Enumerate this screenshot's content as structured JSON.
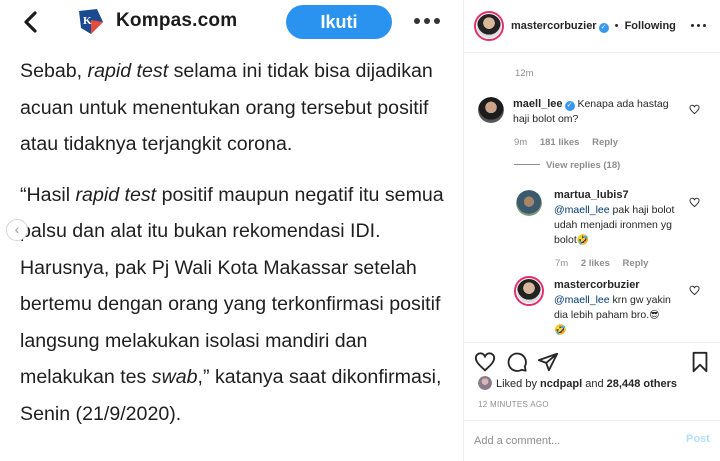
{
  "article": {
    "brand": "Kompas.com",
    "follow_label": "Ikuti",
    "paragraph1": {
      "pre": "Sebab, ",
      "em": "rapid test",
      "post": " selama ini tidak bisa dijadikan acuan untuk menentukan orang tersebut positif atau tidaknya terjangkit corona."
    },
    "paragraph2": {
      "pre": "“Hasil ",
      "em": "rapid test",
      "mid": " positif maupun negatif itu semua palsu dan alat itu bukan rekomendasi IDI. Harusnya, pak Pj Wali Kota Makassar setelah bertemu dengan orang yang terkonfirmasi positif langsung melakukan isolasi mandiri dan melakukan tes ",
      "em2": "swab",
      "post": ",” katanya saat dikonfirmasi, Senin (21/9/2020)."
    },
    "icons": {
      "back": "chevron-left-icon",
      "logo": "kompas-logo-icon",
      "more": "more-horizontal-icon",
      "prev": "carousel-prev-icon"
    }
  },
  "instagram": {
    "header": {
      "username": "mastercorbuzier",
      "separator": "•",
      "following": "Following"
    },
    "earlier_time": "12m",
    "comments": [
      {
        "username": "maell_lee",
        "verified": true,
        "text": "Kenapa ada hastag haji bolot om?",
        "time": "9m",
        "likes": "181 likes",
        "reply": "Reply"
      }
    ],
    "view_replies": "View replies (18)",
    "replies": [
      {
        "username": "martua_lubis7",
        "mention": "@maell_lee",
        "text": " pak haji bolot udah menjadi ironmen yg bolot",
        "emoji": "🤣",
        "time": "7m",
        "likes": "2 likes",
        "reply": "Reply"
      },
      {
        "username": "mastercorbuzier",
        "mention": "@maell_lee",
        "text": " krn gw yakin dia lebih paham bro.",
        "emoji": "😎",
        "emoji2": "🤣"
      }
    ],
    "likes_prefix": "Liked by ",
    "liked_by": "ncdpapl",
    "likes_and": " and ",
    "likes_count": "28,448 others",
    "posted_ago": "12 MINUTES AGO",
    "comment_placeholder": "Add a comment...",
    "post_label": "Post",
    "colors": {
      "accent": "#3897f0",
      "follow_button": "#2a93f0",
      "muted": "#8e8e8e",
      "link": "#00376b"
    }
  }
}
